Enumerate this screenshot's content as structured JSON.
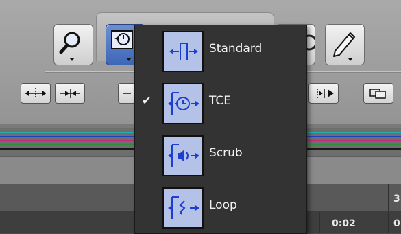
{
  "toolbar": {
    "tools": [
      {
        "icon": "magnifier-icon",
        "active": false
      },
      {
        "icon": "tce-clock-icon",
        "active": true
      },
      {
        "icon": "pencil-icon",
        "active": false
      }
    ],
    "mini_buttons": [
      {
        "icon": "move-arrows-icon"
      },
      {
        "icon": "arrows-inward-icon"
      },
      {
        "icon": "partial-button-icon"
      },
      {
        "icon": "skip-play-icon"
      },
      {
        "icon": "overlap-rects-icon"
      }
    ]
  },
  "menu": {
    "items": [
      {
        "label": "Standard",
        "icon": "standard-mode-icon",
        "checked": false
      },
      {
        "label": "TCE",
        "icon": "tce-mode-icon",
        "checked": true,
        "check_glyph": "✔"
      },
      {
        "label": "Scrub",
        "icon": "scrub-mode-icon",
        "checked": false
      },
      {
        "label": "Loop",
        "icon": "loop-mode-icon",
        "checked": false
      }
    ]
  },
  "tracks": {
    "line_colors": [
      "#20b0b0",
      "#1f3fc7",
      "#c62a7a",
      "#2e8f3a",
      "#1a1a1a"
    ]
  },
  "timeline": {
    "time_display": "0:02",
    "edge_top": "3",
    "edge_bottom": "0"
  },
  "colors": {
    "accent_active": "#3e67b8",
    "icon_blue": "#1d3fd1",
    "menu_bg": "#333333",
    "icon_bg": "#b5c2e7"
  }
}
